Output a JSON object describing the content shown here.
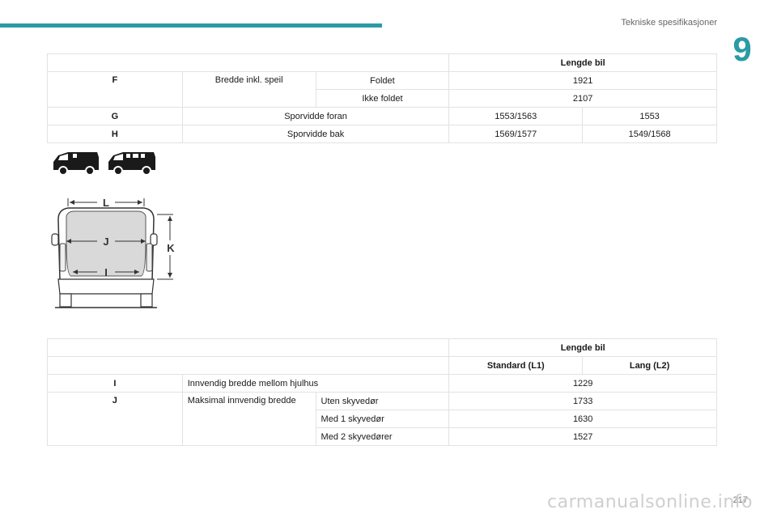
{
  "header": {
    "section_title": "Tekniske spesifikasjoner",
    "chapter_number": "9"
  },
  "table1": {
    "header_label": "Lengde bil",
    "rows": {
      "f": {
        "code": "F",
        "label": "Bredde inkl. speil",
        "folded_label": "Foldet",
        "folded_value": "1921",
        "unfolded_label": "Ikke foldet",
        "unfolded_value": "2107"
      },
      "g": {
        "code": "G",
        "label": "Sporvidde foran",
        "value_a": "1553/1563",
        "value_b": "1553"
      },
      "h": {
        "code": "H",
        "label": "Sporvidde bak",
        "value_a": "1569/1577",
        "value_b": "1549/1568"
      }
    }
  },
  "diagram": {
    "label_l": "L",
    "label_j": "J",
    "label_i": "I",
    "label_k": "K"
  },
  "table2": {
    "header_label": "Lengde bil",
    "col_standard": "Standard (L1)",
    "col_long": "Lang (L2)",
    "rows": {
      "i": {
        "code": "I",
        "label": "Innvendig bredde mellom hjulhus",
        "value": "1229"
      },
      "j": {
        "code": "J",
        "label": "Maksimal innvendig bredde",
        "sub1_label": "Uten skyvedør",
        "sub1_value": "1733",
        "sub2_label": "Med 1 skyvedør",
        "sub2_value": "1630",
        "sub3_label": "Med 2 skyvedører",
        "sub3_value": "1527"
      }
    }
  },
  "footer": {
    "page_number": "217",
    "watermark": "carmanualsonline.info"
  }
}
